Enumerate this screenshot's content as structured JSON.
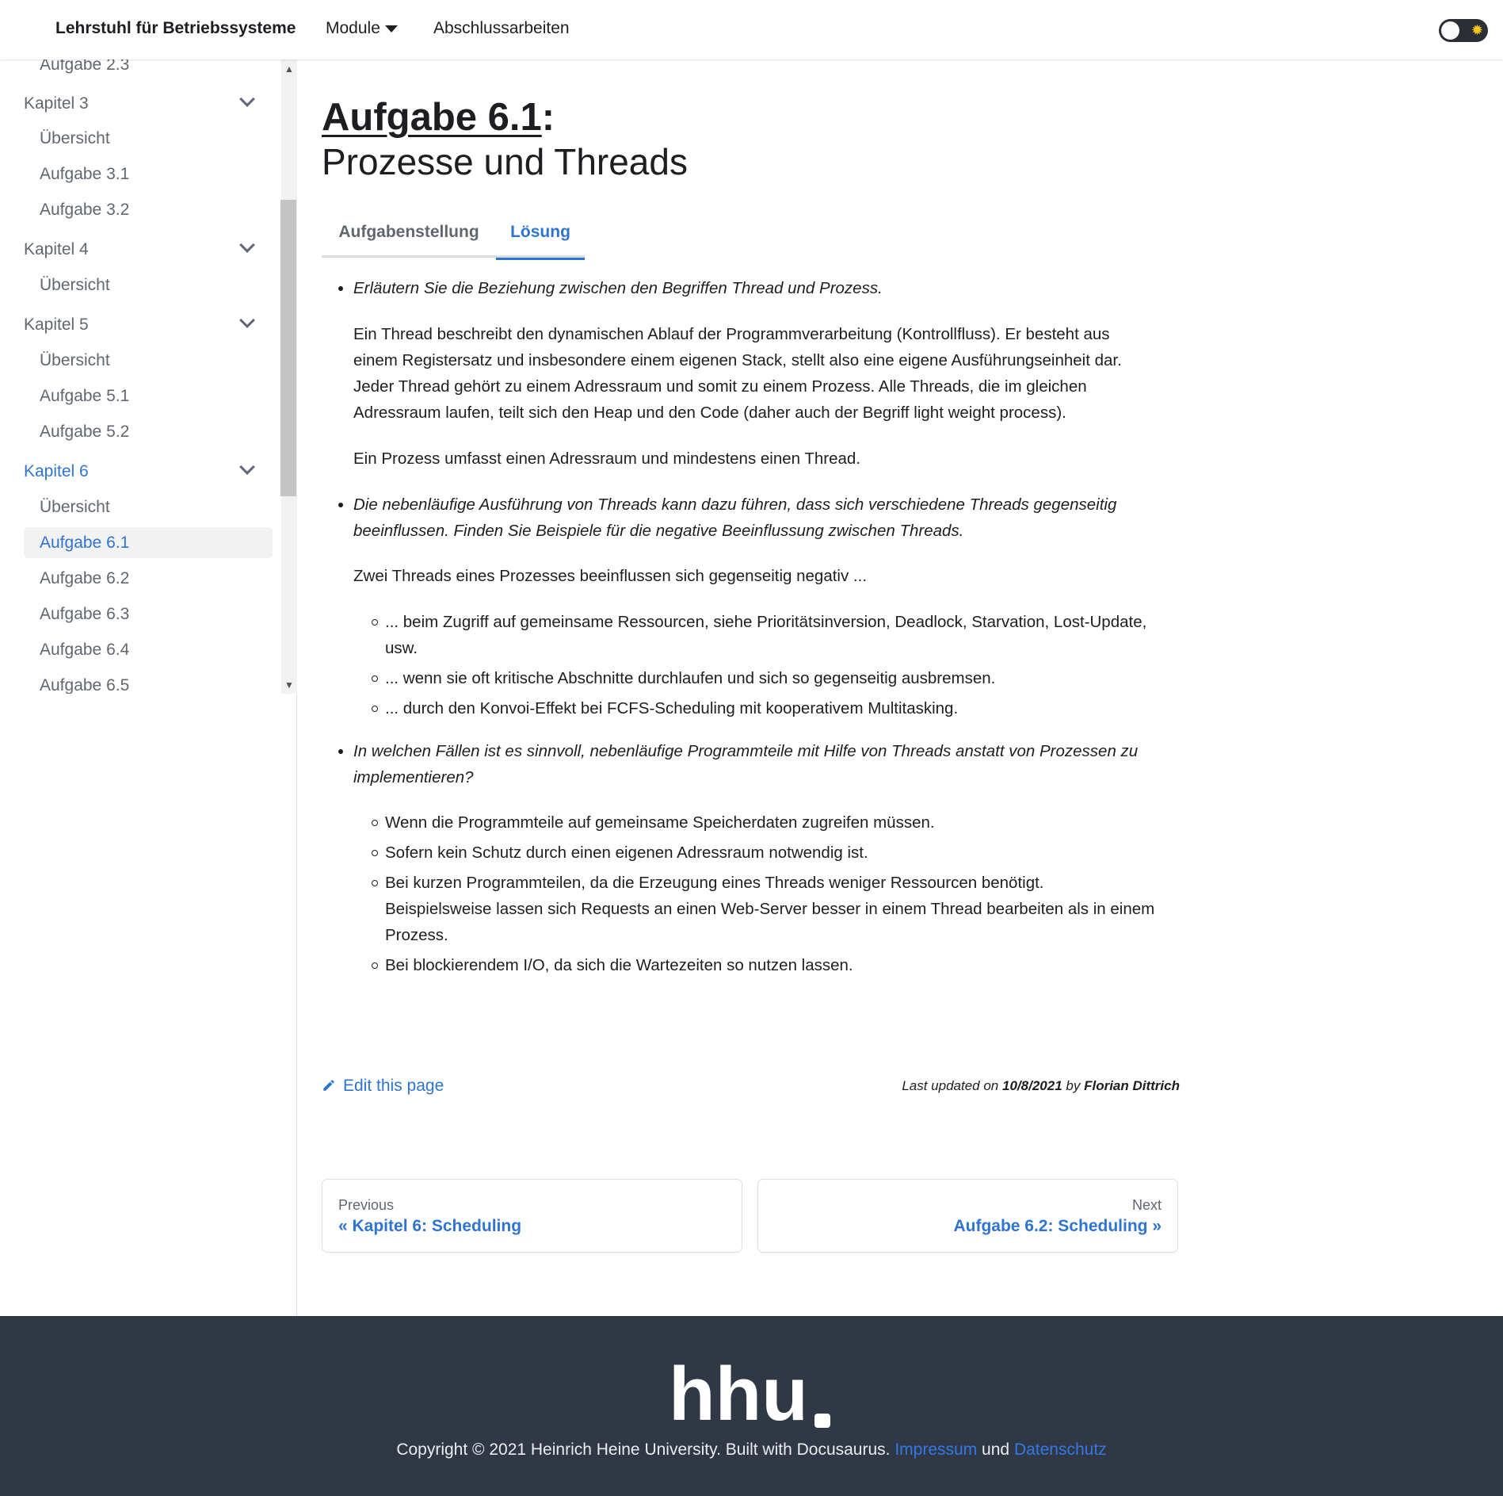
{
  "navbar": {
    "brand": "Lehrstuhl für Betriebssysteme",
    "modules": "Module",
    "theses": "Abschlussarbeiten"
  },
  "sidebar": {
    "items": [
      {
        "label": "Aufgabe 2.3",
        "type": "sub"
      },
      {
        "label": "Kapitel 3",
        "type": "cat"
      },
      {
        "label": "Übersicht",
        "type": "sub"
      },
      {
        "label": "Aufgabe 3.1",
        "type": "sub"
      },
      {
        "label": "Aufgabe 3.2",
        "type": "sub"
      },
      {
        "label": "Kapitel 4",
        "type": "cat"
      },
      {
        "label": "Übersicht",
        "type": "sub"
      },
      {
        "label": "Kapitel 5",
        "type": "cat"
      },
      {
        "label": "Übersicht",
        "type": "sub"
      },
      {
        "label": "Aufgabe 5.1",
        "type": "sub"
      },
      {
        "label": "Aufgabe 5.2",
        "type": "sub"
      },
      {
        "label": "Kapitel 6",
        "type": "cat",
        "active": true
      },
      {
        "label": "Übersicht",
        "type": "sub"
      },
      {
        "label": "Aufgabe 6.1",
        "type": "sub",
        "selected": true
      },
      {
        "label": "Aufgabe 6.2",
        "type": "sub"
      },
      {
        "label": "Aufgabe 6.3",
        "type": "sub"
      },
      {
        "label": "Aufgabe 6.4",
        "type": "sub"
      },
      {
        "label": "Aufgabe 6.5",
        "type": "sub"
      }
    ]
  },
  "page": {
    "title_link": "Aufgabe 6.1",
    "title_colon": ":",
    "subtitle": "Prozesse und Threads",
    "tabs": [
      "Aufgabenstellung",
      "Lösung"
    ],
    "active_tab": "Lösung"
  },
  "content": {
    "q1": "Erläutern Sie die Beziehung zwischen den Begriffen Thread und Prozess.",
    "a1_p1_l1": "Ein Thread beschreibt den dynamischen Ablauf der Programmverarbeitung (Kontrollfluss). Er besteht aus",
    "a1_p1_l2": "einem Registersatz und insbesondere einem eigenen Stack, stellt also eine eigene Ausführungseinheit dar.",
    "a1_p1_l3": "Jeder Thread gehört zu einem Adressraum und somit zu einem Prozess. Alle Threads, die im gleichen",
    "a1_p1_l4": "Adressraum laufen, teilt sich den Heap und den Code (daher auch der Begriff light weight process).",
    "a1_p2": "Ein Prozess umfasst einen Adressraum und mindestens einen Thread.",
    "q2_l1": "Die nebenläufige Ausführung von Threads kann dazu führen, dass sich verschiedene Threads gegenseitig",
    "q2_l2": "beeinflussen. Finden Sie Beispiele für die negative Beeinflussung zwischen Threads.",
    "a2_intro": "Zwei Threads eines Prozesses beeinflussen sich gegenseitig negativ ...",
    "a2_li1_l1": "... beim Zugriff auf gemeinsame Ressourcen, siehe Prioritätsinversion, Deadlock, Starvation, Lost-Update,",
    "a2_li1_l2": "usw.",
    "a2_li2": "... wenn sie oft kritische Abschnitte durchlaufen und sich so gegenseitig ausbremsen.",
    "a2_li3": "... durch den Konvoi-Effekt bei FCFS-Scheduling mit kooperativem Multitasking.",
    "q3_l1": "In welchen Fällen ist es sinnvoll, nebenläufige Programmteile mit Hilfe von Threads anstatt von Prozessen zu",
    "q3_l2": "implementieren?",
    "a3_li1": "Wenn die Programmteile auf gemeinsame Speicherdaten zugreifen müssen.",
    "a3_li2": "Sofern kein Schutz durch einen eigenen Adressraum notwendig ist.",
    "a3_li3_l1": "Bei kurzen Programmteilen, da die Erzeugung eines Threads weniger Ressourcen benötigt.",
    "a3_li3_l2": "Beispielsweise lassen sich Requests an einen Web-Server besser in einem Thread bearbeiten als in einem",
    "a3_li3_l3": "Prozess.",
    "a3_li4": "Bei blockierendem I/O, da sich die Wartezeiten so nutzen lassen."
  },
  "meta": {
    "edit": "Edit this page",
    "updated_prefix": "Last updated on",
    "updated_date": "10/8/2021",
    "updated_by_word": "by",
    "updated_author": "Florian Dittrich"
  },
  "pager": {
    "prev_label": "Previous",
    "prev_title": "« Kapitel 6: Scheduling",
    "next_label": "Next",
    "next_title": "Aufgabe 6.2: Scheduling »"
  },
  "footer": {
    "logo_text": "hhu",
    "copyright": "Copyright © 2021 Heinrich Heine University. Built with Docusaurus.",
    "impressum": "Impressum",
    "und": "und",
    "datenschutz": "Datenschutz"
  },
  "colors": {
    "accent": "#2f74d0",
    "footer_bg": "#303846",
    "text": "#1c1e21",
    "muted": "#606770"
  }
}
